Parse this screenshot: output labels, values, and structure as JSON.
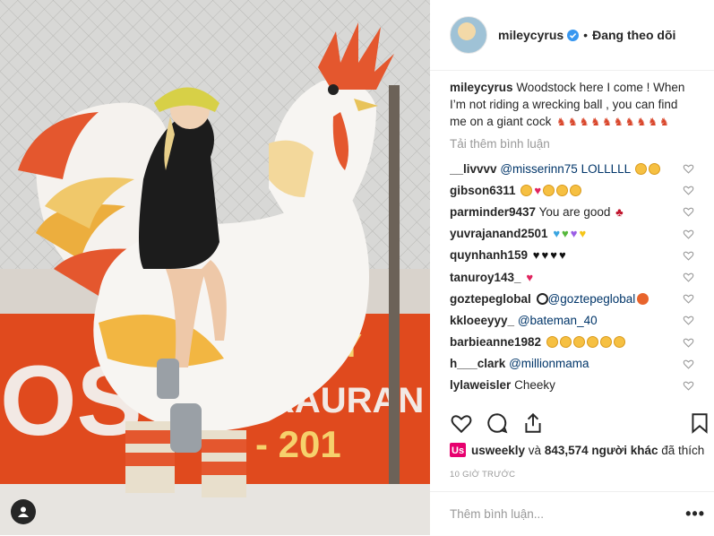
{
  "post": {
    "username": "mileycyrus",
    "dot": "•",
    "follow_status": "Đang theo dõi",
    "caption_user": "mileycyrus",
    "caption_text": "Woodstock here I come ! When I’m not riding a wrecking ball , you can find me on a giant cock",
    "caption_emojis": [
      "rooster",
      "rooster",
      "rooster",
      "rooster",
      "rooster",
      "rooster",
      "rooster",
      "rooster",
      "rooster",
      "rooster"
    ],
    "load_more": "Tải thêm bình luận"
  },
  "comments": [
    {
      "user": "__livvvv",
      "text": "@misserinn75 LOLLLLL",
      "emoji": "laugh laugh"
    },
    {
      "user": "gibson6311",
      "text": "",
      "emoji": "laugh heart-r laugh laugh laugh"
    },
    {
      "user": "parminder9437",
      "text": "You are good",
      "emoji": "cherry"
    },
    {
      "user": "yuvrajanand2501",
      "text": "",
      "emoji": "blue green purple yellow"
    },
    {
      "user": "quynhanh159",
      "text": "",
      "emoji": "black black black black"
    },
    {
      "user": "tanuroy143_",
      "text": "",
      "emoji": "heart-r"
    },
    {
      "user": "goztepeglobal",
      "text": "@goztepeglobal",
      "emoji": "ball|bball"
    },
    {
      "user": "kkloeeyyy_",
      "text": "@bateman_40",
      "emoji": ""
    },
    {
      "user": "barbieanne1982",
      "text": "",
      "emoji": "laugh laugh laugh laugh laugh laugh"
    },
    {
      "user": "h___clark",
      "text": "@millionmama",
      "emoji": ""
    },
    {
      "user": "lylaweisler",
      "text": "Cheeky",
      "emoji": ""
    }
  ],
  "likes": {
    "first_user": "usweekly",
    "middle": " và ",
    "count_text": "843,574 người khác",
    "suffix": " đã thích"
  },
  "timestamp": "10 GIỜ TRƯỚC",
  "add_comment_placeholder": "Thêm bình luận...",
  "more_options": "•••",
  "photo": {
    "banner_text_left": "OS",
    "banner_text_right": "RAURAN",
    "banner_years": "1 - 201",
    "banner_top": "Y"
  },
  "colors": {
    "accent_blue": "#3897f0",
    "brand_usweekly": "#e7006e",
    "muted": "#999999",
    "banner_red": "#e04a1e"
  }
}
